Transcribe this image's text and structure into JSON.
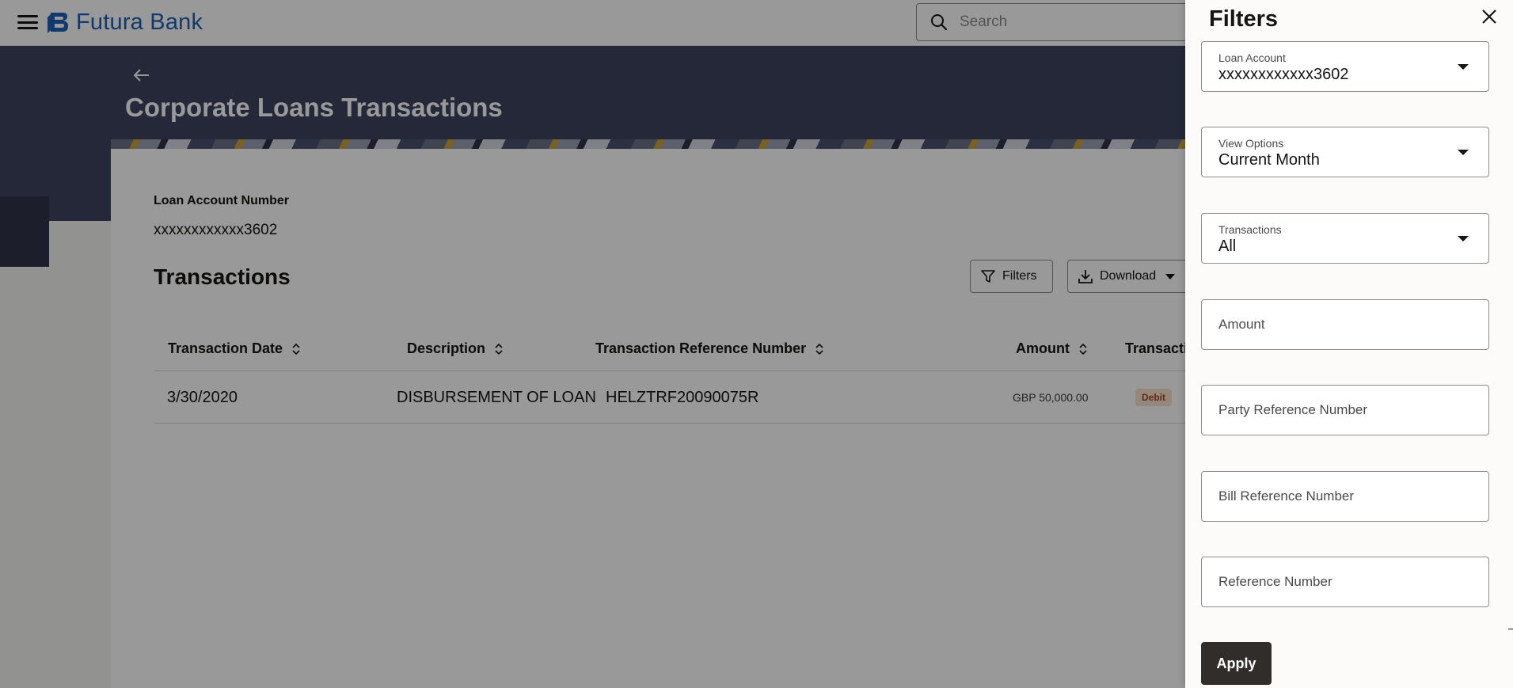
{
  "header": {
    "brand": "Futura Bank",
    "search_placeholder": "Search"
  },
  "page": {
    "title": "Corporate Loans Transactions",
    "account_label": "Loan Account Number",
    "account_value": "xxxxxxxxxxxx3602",
    "section_title": "Transactions",
    "filters_label": "Filters",
    "download_label": "Download"
  },
  "table": {
    "columns": [
      "Transaction Date",
      "Description",
      "Transaction Reference Number",
      "Amount",
      "Transacti"
    ],
    "rows": [
      {
        "date": "3/30/2020",
        "description": "DISBURSEMENT OF LOAN",
        "reference": "HELZTRF20090075R",
        "amount": "GBP 50,000.00",
        "type": "Debit"
      }
    ]
  },
  "drawer": {
    "title": "Filters",
    "loan_account": {
      "label": "Loan Account",
      "value": "xxxxxxxxxxxx3602"
    },
    "view_options": {
      "label": "View Options",
      "value": "Current Month"
    },
    "transactions": {
      "label": "Transactions",
      "value": "All"
    },
    "amount_placeholder": "Amount",
    "party_ref_placeholder": "Party Reference Number",
    "bill_ref_placeholder": "Bill Reference Number",
    "ref_placeholder": "Reference Number",
    "apply_label": "Apply"
  },
  "colors": {
    "brand_blue": "#1d5fb4",
    "hero_bg": "#3d4460",
    "apply_bg": "#312d2a",
    "debit_badge_bg": "#fbe1d1",
    "debit_badge_text": "#a44a14"
  }
}
